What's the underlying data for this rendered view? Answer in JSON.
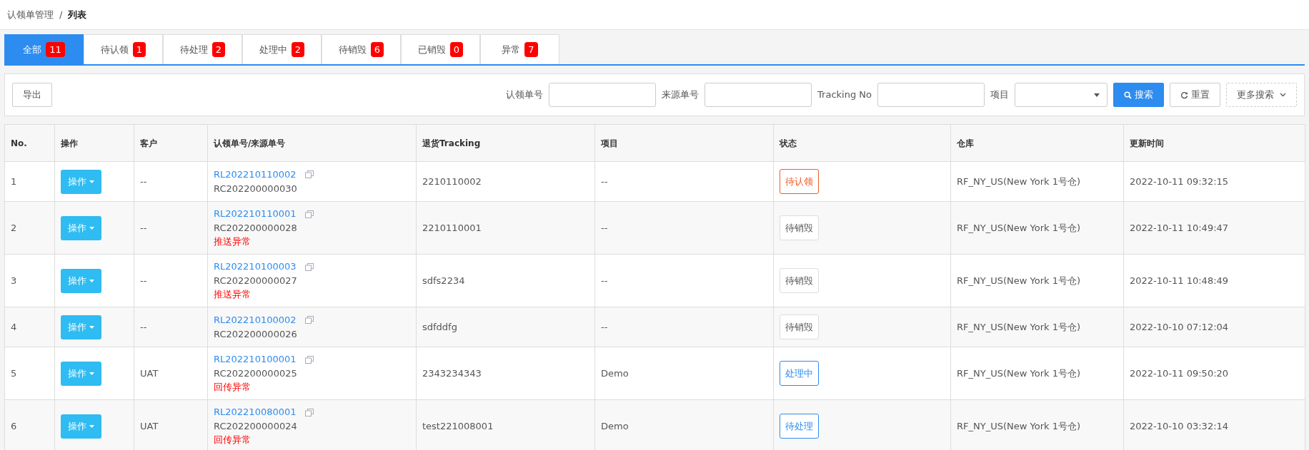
{
  "breadcrumb": {
    "parent": "认领单管理",
    "separator": "/",
    "current": "列表"
  },
  "tabs": [
    {
      "label": "全部",
      "count": "11",
      "selected": true
    },
    {
      "label": "待认领",
      "count": "1",
      "selected": false
    },
    {
      "label": "待处理",
      "count": "2",
      "selected": false
    },
    {
      "label": "处理中",
      "count": "2",
      "selected": false
    },
    {
      "label": "待销毁",
      "count": "6",
      "selected": false
    },
    {
      "label": "已销毁",
      "count": "0",
      "selected": false
    },
    {
      "label": "异常",
      "count": "7",
      "selected": false
    }
  ],
  "toolbar": {
    "export_button": "导出",
    "filters": [
      {
        "label": "认领单号",
        "kind": "text"
      },
      {
        "label": "来源单号",
        "kind": "text"
      },
      {
        "label": "Tracking No",
        "kind": "text"
      },
      {
        "label": "项目",
        "kind": "select"
      }
    ],
    "search_button": "搜索",
    "reset_button": "重置",
    "more_button": "更多搜索"
  },
  "table": {
    "columns": [
      "No.",
      "操作",
      "客户",
      "认领单号/来源单号",
      "退货Tracking",
      "项目",
      "状态",
      "仓库",
      "更新时间"
    ],
    "rows": [
      {
        "no": "1",
        "action": "操作",
        "customer": "--",
        "claim_no": "RL202210110002",
        "source_no": "RC202200000030",
        "note": "",
        "tracking": "2210110002",
        "project": "--",
        "status": {
          "label": "待认领",
          "kind": "claim"
        },
        "warehouse": "RF_NY_US(New York 1号仓)",
        "updated": "2022-10-11 09:32:15"
      },
      {
        "no": "2",
        "action": "操作",
        "customer": "--",
        "claim_no": "RL202210110001",
        "source_no": "RC202200000028",
        "note": "推送异常",
        "tracking": "2210110001",
        "project": "--",
        "status": {
          "label": "待销毁",
          "kind": "destroy"
        },
        "warehouse": "RF_NY_US(New York 1号仓)",
        "updated": "2022-10-11 10:49:47"
      },
      {
        "no": "3",
        "action": "操作",
        "customer": "--",
        "claim_no": "RL202210100003",
        "source_no": "RC202200000027",
        "note": "推送异常",
        "tracking": "sdfs2234",
        "project": "--",
        "status": {
          "label": "待销毁",
          "kind": "destroy"
        },
        "warehouse": "RF_NY_US(New York 1号仓)",
        "updated": "2022-10-11 10:48:49"
      },
      {
        "no": "4",
        "action": "操作",
        "customer": "--",
        "claim_no": "RL202210100002",
        "source_no": "RC202200000026",
        "note": "",
        "tracking": "sdfddfg",
        "project": "--",
        "status": {
          "label": "待销毁",
          "kind": "destroy"
        },
        "warehouse": "RF_NY_US(New York 1号仓)",
        "updated": "2022-10-10 07:12:04"
      },
      {
        "no": "5",
        "action": "操作",
        "customer": "UAT",
        "claim_no": "RL202210100001",
        "source_no": "RC202200000025",
        "note": "回传异常",
        "tracking": "2343234343",
        "project": "Demo",
        "status": {
          "label": "处理中",
          "kind": "process"
        },
        "warehouse": "RF_NY_US(New York 1号仓)",
        "updated": "2022-10-11 09:50:20"
      },
      {
        "no": "6",
        "action": "操作",
        "customer": "UAT",
        "claim_no": "RL202210080001",
        "source_no": "RC202200000024",
        "note": "回传异常",
        "tracking": "test221008001",
        "project": "Demo",
        "status": {
          "label": "待处理",
          "kind": "process"
        },
        "warehouse": "RF_NY_US(New York 1号仓)",
        "updated": "2022-10-10 03:32:14"
      }
    ]
  }
}
